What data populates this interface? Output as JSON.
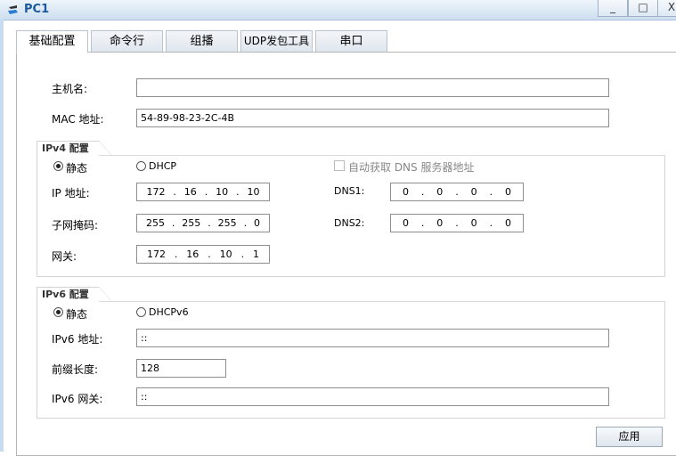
{
  "window": {
    "title": "PC1",
    "minimize": "_",
    "maximize": "□",
    "close": "X"
  },
  "tabs": [
    "基础配置",
    "命令行",
    "组播",
    "UDP发包工具",
    "串口"
  ],
  "basic": {
    "hostname_label": "主机名:",
    "hostname_value": "",
    "mac_label": "MAC 地址:",
    "mac_value": "54-89-98-23-2C-4B"
  },
  "ipv4": {
    "group_label": "IPv4 配置",
    "static_label": "静态",
    "dhcp_label": "DHCP",
    "auto_dns_label": "自动获取 DNS 服务器地址",
    "ip_label": "IP 地址:",
    "ip": [
      "172",
      "16",
      "10",
      "10"
    ],
    "mask_label": "子网掩码:",
    "mask": [
      "255",
      "255",
      "255",
      "0"
    ],
    "gw_label": "网关:",
    "gw": [
      "172",
      "16",
      "10",
      "1"
    ],
    "dns1_label": "DNS1:",
    "dns1": [
      "0",
      "0",
      "0",
      "0"
    ],
    "dns2_label": "DNS2:",
    "dns2": [
      "0",
      "0",
      "0",
      "0"
    ]
  },
  "ipv6": {
    "group_label": "IPv6 配置",
    "static_label": "静态",
    "dhcp_label": "DHCPv6",
    "addr_label": "IPv6 地址:",
    "addr_value": "::",
    "prefix_label": "前缀长度:",
    "prefix_value": "128",
    "gw_label": "IPv6 网关:",
    "gw_value": "::"
  },
  "apply_label": "应用"
}
